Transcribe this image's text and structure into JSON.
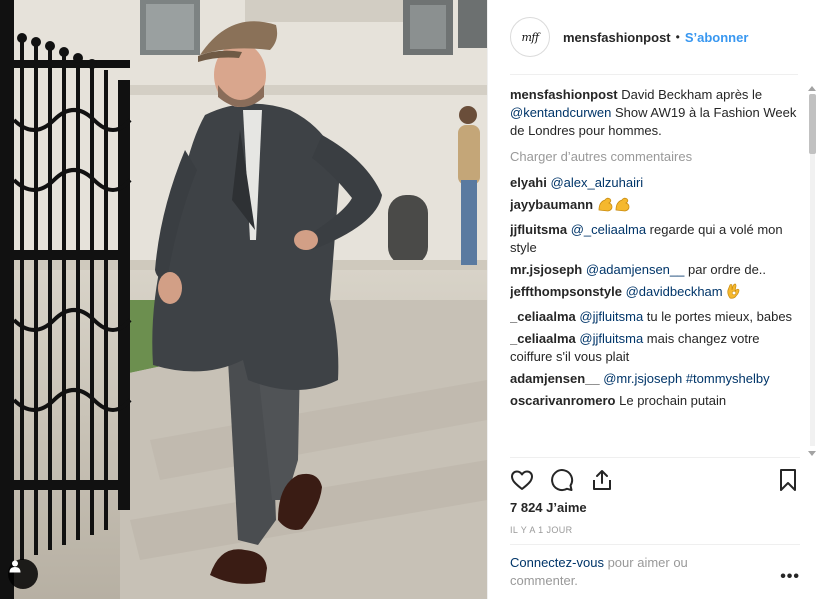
{
  "post": {
    "username": "mensfashionpost",
    "avatar_text": "mff",
    "separator": "•",
    "follow_label": "S’abonner"
  },
  "caption": {
    "user": "mensfashionpost",
    "text_before": "David Beckham après le",
    "mention": "@kentandcurwen",
    "text_after": "Show AW19 à la Fashion Week de Londres pour hommes."
  },
  "load_more_label": "Charger d’autres commentaires",
  "comments": [
    {
      "user": "elyahi",
      "mention": "@alex_alzuhairi",
      "text": ""
    },
    {
      "user": "jayybaumann",
      "mention": "",
      "text": ""
    },
    {
      "user": "jjfluitsma",
      "mention": "@_celiaalma",
      "text": "regarde qui a volé mon style"
    },
    {
      "user": "mr.jsjoseph",
      "mention": "@adamjensen__",
      "text": "par ordre de.."
    },
    {
      "user": "jeffthompsonstyle",
      "mention": "@davidbeckham",
      "text": ""
    },
    {
      "user": "_celiaalma",
      "mention": "@jjfluitsma",
      "text": "tu le portes mieux, babes"
    },
    {
      "user": "_celiaalma",
      "mention": "@jjfluitsma",
      "text": "mais changez votre coiffure s'il vous plait"
    },
    {
      "user": "adamjensen__",
      "mention": "@mr.jsjoseph",
      "text": ""
    },
    {
      "user": "oscarivanromero",
      "mention": "",
      "text": "Le prochain putain"
    }
  ],
  "comment_extra_mention": "#tommyshelby",
  "likes_label": "7 824 J’aime",
  "timestamp": "IL Y A 1 JOUR",
  "login": {
    "link": "Connectez-vous",
    "text": "pour aimer ou commenter."
  },
  "more_label": "•••",
  "colors": {
    "link_blue": "#3897f0",
    "mention_navy": "#003569",
    "muted": "#999999",
    "emoji_yellow": "#f5b82e"
  }
}
